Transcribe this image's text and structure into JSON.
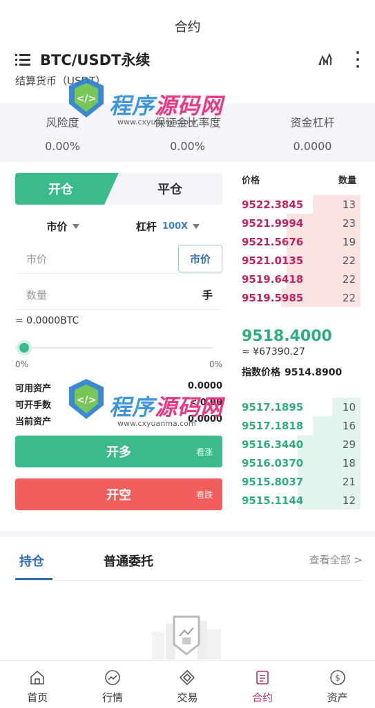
{
  "header": {
    "title": "合约"
  },
  "symbol": {
    "name": "BTC/USDT永续",
    "settle_label": "结算货币（USDT）"
  },
  "stats": [
    {
      "label": "风险度",
      "value": "0.00%"
    },
    {
      "label": "保证金比率度",
      "value": "0.00%"
    },
    {
      "label": "资金杠杆",
      "value": "0.0000"
    }
  ],
  "trade": {
    "tab_open": "开仓",
    "tab_close": "平仓",
    "order_type": "市价",
    "leverage_label": "杠杆",
    "leverage_value": "100X",
    "price_placeholder": "市价",
    "market_button": "市价",
    "qty_placeholder": "数量",
    "qty_unit": "手",
    "approx": "= 0.0000BTC",
    "slider_percent": 0,
    "pct_min": "0%",
    "pct_max": "0%",
    "assets": [
      {
        "label": "可用资产",
        "value": "0.0000"
      },
      {
        "label": "可开手数",
        "value": "< 0.00"
      },
      {
        "label": "当前资产",
        "value": "0.0000"
      }
    ],
    "long_label": "开多",
    "long_sub": "看涨",
    "short_label": "开空",
    "short_sub": "看跌"
  },
  "orderbook": {
    "price_header": "价格",
    "qty_header": "数量",
    "asks": [
      {
        "price": "9522.3845",
        "qty": "13",
        "depth": 0.4
      },
      {
        "price": "9521.9994",
        "qty": "23",
        "depth": 0.62
      },
      {
        "price": "9521.5676",
        "qty": "19",
        "depth": 0.62
      },
      {
        "price": "9521.0135",
        "qty": "22",
        "depth": 0.62
      },
      {
        "price": "9519.6418",
        "qty": "22",
        "depth": 0.62
      },
      {
        "price": "9519.5985",
        "qty": "22",
        "depth": 0.67
      }
    ],
    "last_price": "9518.4000",
    "cny_price": "≈ ¥67390.27",
    "index_label": "指数价格",
    "index_price": "9514.8900",
    "bids": [
      {
        "price": "9517.1895",
        "qty": "10",
        "depth": 0.24
      },
      {
        "price": "9517.1818",
        "qty": "16",
        "depth": 0.4
      },
      {
        "price": "9516.3440",
        "qty": "29",
        "depth": 0.53
      },
      {
        "price": "9516.0370",
        "qty": "18",
        "depth": 0.53
      },
      {
        "price": "9515.8037",
        "qty": "21",
        "depth": 0.53
      },
      {
        "price": "9515.1144",
        "qty": "12",
        "depth": 0.53
      }
    ]
  },
  "positions": {
    "tab_hold": "持仓",
    "tab_orders": "普通委托",
    "view_all": "查看全部 >"
  },
  "nav": [
    {
      "label": "首页",
      "icon": "home-icon",
      "active": false
    },
    {
      "label": "行情",
      "icon": "market-icon",
      "active": false
    },
    {
      "label": "交易",
      "icon": "trade-icon",
      "active": false
    },
    {
      "label": "合约",
      "icon": "contract-icon",
      "active": true
    },
    {
      "label": "资产",
      "icon": "asset-icon",
      "active": false
    }
  ],
  "watermark": {
    "title_a": "程序",
    "title_b": "源码网",
    "url": "www.cxyuanma.com"
  },
  "colors": {
    "green": "#3bba8c",
    "red": "#f25d5d",
    "ask_price": "#c0245e",
    "accent_blue": "#2f6fb5",
    "nav_active": "#b3326a"
  }
}
